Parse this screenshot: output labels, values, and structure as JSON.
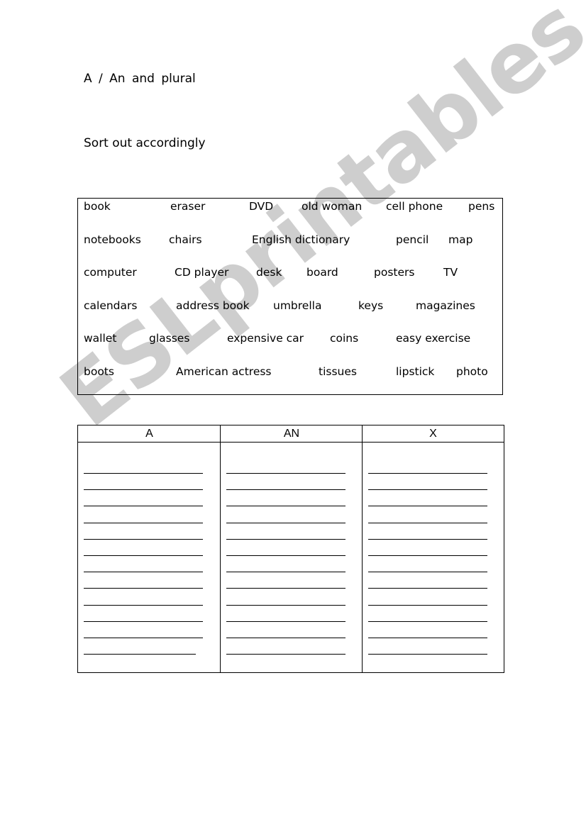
{
  "title": "A  / An  and  plural",
  "subtitle": "Sort out accordingly",
  "word_box": {
    "rows": [
      [
        "book",
        "eraser",
        "DVD",
        "old woman",
        "cell phone",
        "pens"
      ],
      [
        "notebooks",
        "chairs",
        "English dictionary",
        "pencil",
        "map"
      ],
      [
        "computer",
        "CD player",
        "desk",
        "board",
        "posters",
        "TV"
      ],
      [
        "calendars",
        "address book",
        "umbrella",
        "keys",
        "magazines"
      ],
      [
        "wallet",
        "glasses",
        "expensive car",
        "coins",
        "easy exercise"
      ],
      [
        "boots",
        "American actress",
        "tissues",
        "lipstick",
        "photo"
      ]
    ]
  },
  "sort_table": {
    "columns": [
      {
        "header": "A",
        "blank_lines": 12
      },
      {
        "header": "AN",
        "blank_lines": 12
      },
      {
        "header": "X",
        "blank_lines": 12
      }
    ]
  },
  "watermark": "ESLprintables.com",
  "colors": {
    "watermark": "#c9c9c9",
    "text": "#000000"
  }
}
